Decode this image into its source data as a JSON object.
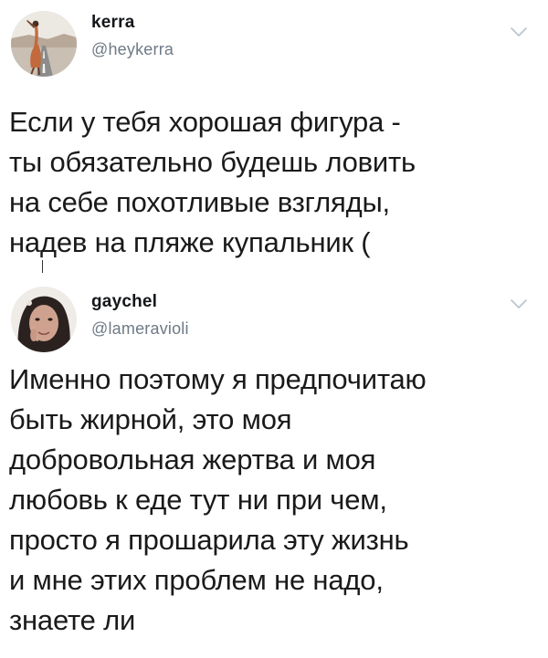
{
  "tweets": [
    {
      "name": "kerra",
      "handle": "@heykerra",
      "lines": [
        "Если у тебя хорошая фигура -",
        "ты обязательно будешь ловить",
        "на себе похотливые взгляды,",
        "надев на пляже купальник ("
      ],
      "avatar_icon": "avatar-photo-road"
    },
    {
      "name": "gaychel",
      "handle": "@lameravioli",
      "lines": [
        "Именно поэтому я предпочитаю",
        "быть жирной, это моя",
        "добровольная жертва и моя",
        "любовь к еде тут ни при чем,",
        "просто я прошарила эту жизнь",
        "и мне этих проблем не надо,",
        "знаете ли"
      ],
      "avatar_icon": "avatar-photo-selfie"
    }
  ],
  "colors": {
    "handle": "#6e7a86",
    "name": "#14171a",
    "body": "#1a1a1a",
    "chevron": "#b9c3cc"
  }
}
